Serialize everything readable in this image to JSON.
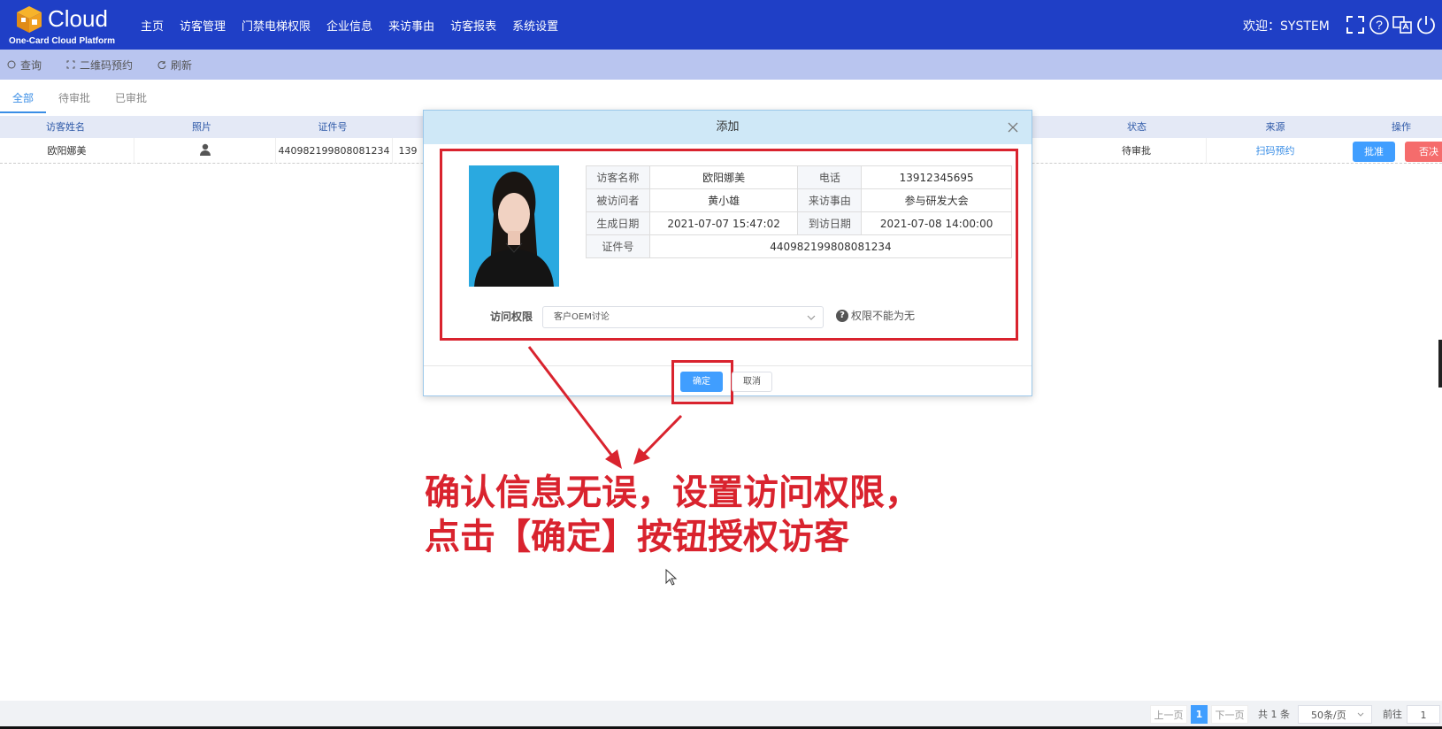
{
  "brand": {
    "name": "Cloud",
    "subtitle": "One-Card Cloud Platform"
  },
  "nav": {
    "items": [
      "主页",
      "访客管理",
      "门禁电梯权限",
      "企业信息",
      "来访事由",
      "访客报表",
      "系统设置"
    ]
  },
  "header": {
    "welcome": "欢迎：SYSTEM"
  },
  "toolbar": {
    "query": "查询",
    "qr": "二维码预约",
    "refresh": "刷新"
  },
  "tabs": [
    "全部",
    "待审批",
    "已审批"
  ],
  "table": {
    "columns": [
      "访客姓名",
      "照片",
      "证件号",
      "状态",
      "来源",
      "操作"
    ],
    "rows": [
      {
        "name": "欧阳娜美",
        "id_no": "440982199808081234",
        "phone_partial": "139",
        "status": "待审批",
        "source": "扫码预约",
        "approve": "批准",
        "reject": "否决"
      }
    ]
  },
  "dialog": {
    "title": "添加",
    "labels": {
      "visitor_name": "访客名称",
      "phone": "电话",
      "host": "被访问者",
      "reason": "来访事由",
      "created": "生成日期",
      "visit_date": "到访日期",
      "id_no": "证件号"
    },
    "values": {
      "visitor_name": "欧阳娜美",
      "phone": "13912345695",
      "host": "黄小雄",
      "reason": "参与研发大会",
      "created": "2021-07-07 15:47:02",
      "visit_date": "2021-07-08 14:00:00",
      "id_no": "440982199808081234"
    },
    "permission_label": "访问权限",
    "permission_value": "客户OEM讨论",
    "permission_hint": "权限不能为无",
    "ok": "确定",
    "cancel": "取消"
  },
  "annotation": {
    "line1": "确认信息无误，设置访问权限，",
    "line2": "点击【确定】按钮授权访客"
  },
  "pagination": {
    "prev": "上一页",
    "current": "1",
    "next": "下一页",
    "total": "共 1 条",
    "page_size": "50条/页",
    "goto_label": "前往",
    "goto_value": "1"
  },
  "colors": {
    "nav_bg": "#1f3fc6",
    "toolbar_bg": "#b9c5ef",
    "primary": "#409eff",
    "danger": "#f56c6c",
    "annotation": "#d9232e"
  }
}
